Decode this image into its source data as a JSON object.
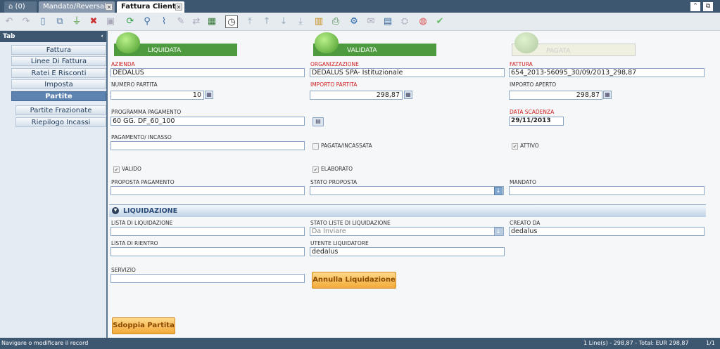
{
  "tabs": {
    "home_label": "(0)",
    "tab1": "Mandato/Reversale",
    "tab2": "Fattura Cliente"
  },
  "sidebar": {
    "header": "Tab",
    "items": [
      "Fattura",
      "Linee Di Fattura",
      "Ratei E Risconti",
      "Imposta",
      "Partite",
      "Partite Frazionate",
      "Riepilogo Incassi"
    ]
  },
  "status_badges": [
    "LIQUIDATA",
    "VALIDATA",
    "PAGATA"
  ],
  "fields": {
    "azienda": {
      "label": "AZIENDA",
      "value": "DEDALUS"
    },
    "organizzazione": {
      "label": "ORGANIZZAZIONE",
      "value": "DEDALUS SPA- Istituzionale"
    },
    "fattura": {
      "label": "FATTURA",
      "value": "654_2013-56095_30/09/2013_298,87"
    },
    "numero_partita": {
      "label": "NUMERO PARTITA",
      "value": "10"
    },
    "importo_partita": {
      "label": "IMPORTO PARTITA",
      "value": "298,87"
    },
    "importo_aperto": {
      "label": "IMPORTO APERTO",
      "value": "298,87"
    },
    "programma_pagamento": {
      "label": "PROGRAMMA PAGAMENTO",
      "value": "60 GG. DF_60_100"
    },
    "data_scadenza": {
      "label": "DATA SCADENZA",
      "value": "29/11/2013"
    },
    "pagamento_incasso": {
      "label": "PAGAMENTO/ INCASSO",
      "value": ""
    },
    "pagata_incassata": {
      "label": "PAGATA/INCASSATA"
    },
    "attivo": {
      "label": "ATTIVO"
    },
    "valido": {
      "label": "VALIDO"
    },
    "elaborato": {
      "label": "ELABORATO"
    },
    "proposta_pagamento": {
      "label": "PROPOSTA PAGAMENTO",
      "value": ""
    },
    "stato_proposta": {
      "label": "STATO PROPOSTA",
      "value": ""
    },
    "mandato": {
      "label": "MANDATO",
      "value": ""
    }
  },
  "liquidazione": {
    "section_title": "LIQUIDAZIONE",
    "lista_liquidazione": {
      "label": "LISTA DI LIQUIDAZIONE",
      "value": ""
    },
    "stato_liste": {
      "label": "STATO LISTE DI LIQUIDAZIONE",
      "value": "Da Inviare"
    },
    "creato_da": {
      "label": "CREATO DA",
      "value": "dedalus"
    },
    "lista_rientro": {
      "label": "LISTA DI RIENTRO",
      "value": ""
    },
    "utente_liquidatore": {
      "label": "UTENTE LIQUIDATORE",
      "value": "dedalus"
    },
    "servizio": {
      "label": "SERVIZIO",
      "value": ""
    },
    "annulla_button": "Annulla Liquidazione"
  },
  "sdoppia_button": "Sdoppia Partita",
  "statusbar": {
    "left": "Navigare o modificare il record",
    "right": "1 Line(s) - 298,87 - Total: EUR 298,87",
    "page": "1/1"
  },
  "colors": {
    "header": "#3e5771",
    "green": "#4e9b3f",
    "orange": "#f2aa3a"
  }
}
